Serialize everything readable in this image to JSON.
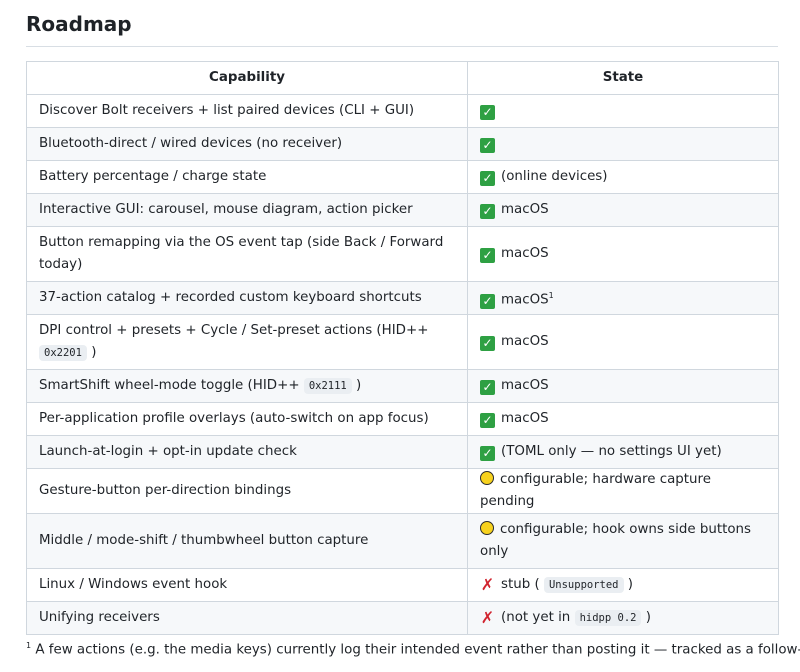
{
  "heading": "Roadmap",
  "table": {
    "headers": {
      "capability": "Capability",
      "state": "State"
    },
    "rows": [
      {
        "capability": "Discover Bolt receivers + list paired devices (CLI + GUI)",
        "icon": "green-check-icon",
        "state": ""
      },
      {
        "capability": "Bluetooth-direct / wired devices (no receiver)",
        "icon": "green-check-icon",
        "state": ""
      },
      {
        "capability": "Battery percentage / charge state",
        "icon": "green-check-icon",
        "state": "(online devices)"
      },
      {
        "capability": "Interactive GUI: carousel, mouse diagram, action picker",
        "icon": "green-check-icon",
        "state": "macOS"
      },
      {
        "capability": "Button remapping via the OS event tap (side Back / Forward today)",
        "icon": "green-check-icon",
        "state": "macOS"
      },
      {
        "capability": "37-action catalog + recorded custom keyboard shortcuts",
        "icon": "green-check-icon",
        "state": "macOS",
        "state_sup": "1"
      },
      {
        "capability": "DPI control + presets + Cycle / Set-preset actions (HID++",
        "capability_code": "0x2201",
        "capability_after": ")",
        "icon": "green-check-icon",
        "state": "macOS"
      },
      {
        "capability": "SmartShift wheel-mode toggle (HID++",
        "capability_code": "0x2111",
        "capability_after": ")",
        "icon": "green-check-icon",
        "state": "macOS"
      },
      {
        "capability": "Per-application profile overlays (auto-switch on app focus)",
        "icon": "green-check-icon",
        "state": "macOS"
      },
      {
        "capability": "Launch-at-login + opt-in update check",
        "icon": "green-check-icon",
        "state": "(TOML only — no settings UI yet)"
      },
      {
        "capability": "Gesture-button per-direction bindings",
        "icon": "yellow-circle-icon",
        "state": "configurable; hardware capture pending"
      },
      {
        "capability": "Middle / mode-shift / thumbwheel button capture",
        "icon": "yellow-circle-icon",
        "state": "configurable; hook owns side buttons only"
      },
      {
        "capability": "Linux / Windows event hook",
        "icon": "red-x-icon",
        "state": "stub (",
        "state_code": "Unsupported",
        "state_after": ")"
      },
      {
        "capability": "Unifying receivers",
        "icon": "red-x-icon",
        "state": "(not yet in",
        "state_code": "hidpp 0.2",
        "state_after": ")"
      }
    ]
  },
  "footnote": {
    "marker": "1",
    "text": "A few actions (e.g. the media keys) currently log their intended event rather than posting it — tracked as a follow-up."
  }
}
